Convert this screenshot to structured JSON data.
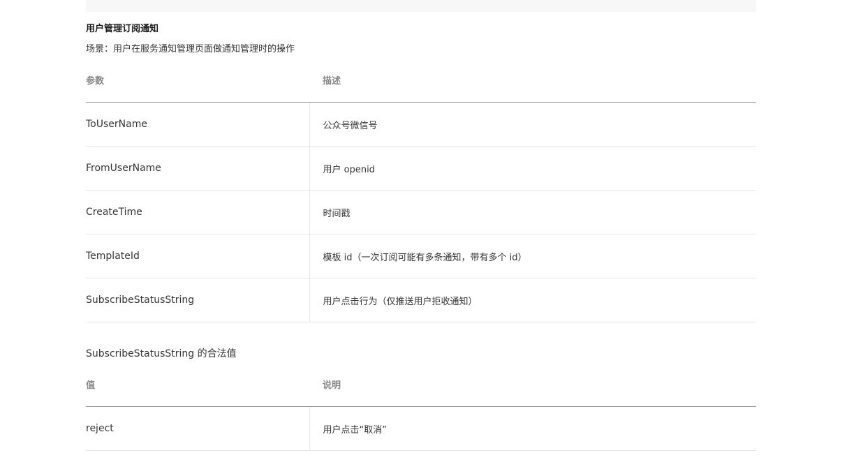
{
  "section": {
    "title": "用户管理订阅通知",
    "scene": "场景：用户在服务通知管理页面做通知管理时的操作"
  },
  "params_table": {
    "headers": [
      "参数",
      "描述"
    ],
    "rows": [
      [
        "ToUserName",
        "公众号微信号"
      ],
      [
        "FromUserName",
        "用户 openid"
      ],
      [
        "CreateTime",
        "时间戳"
      ],
      [
        "TemplateId",
        "模板 id（一次订阅可能有多条通知，带有多个 id）"
      ],
      [
        "SubscribeStatusString",
        "用户点击行为（仅推送用户拒收通知）"
      ]
    ]
  },
  "values_section": {
    "title": "SubscribeStatusString 的合法值",
    "headers": [
      "值",
      "说明"
    ],
    "rows": [
      [
        "reject",
        "用户点击“取消”"
      ]
    ]
  }
}
